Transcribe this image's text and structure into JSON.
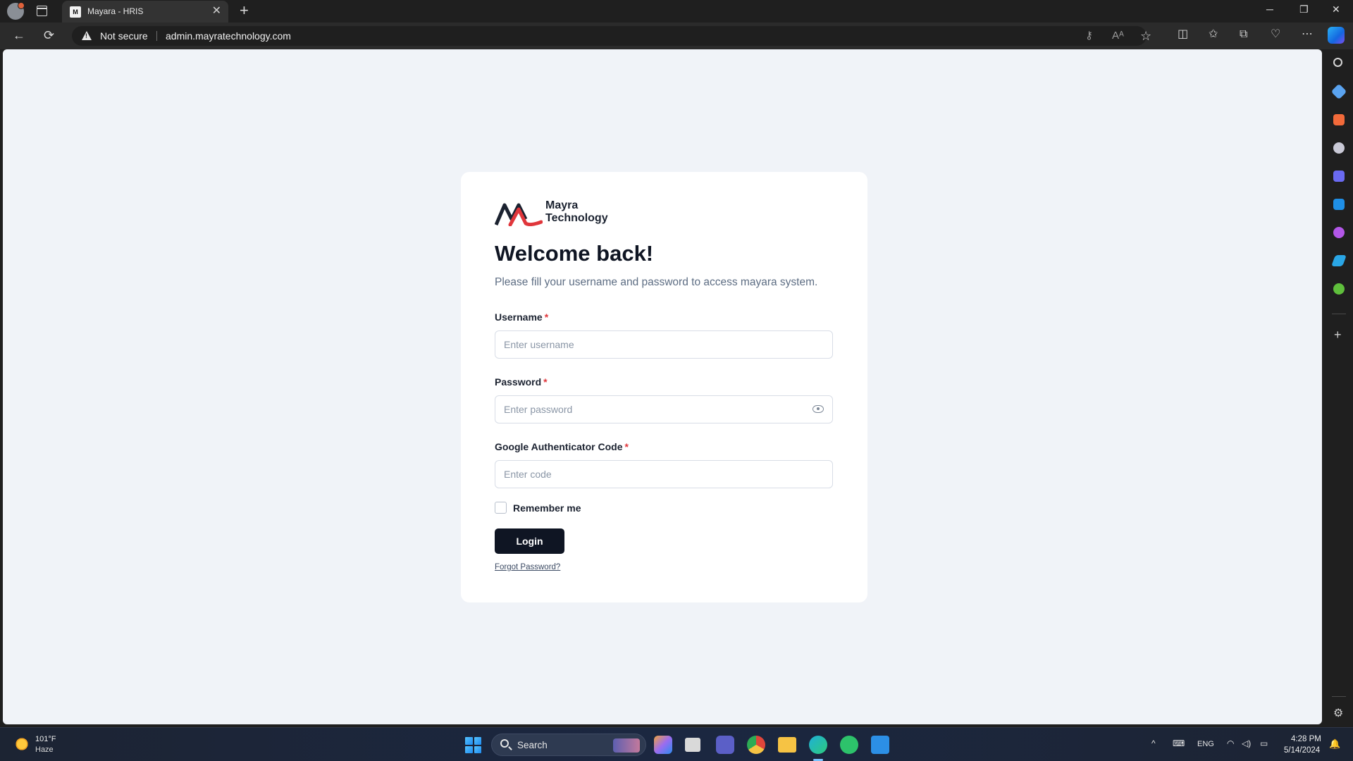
{
  "browser": {
    "tab_title": "Mayara - HRIS",
    "tab_favicon": "M",
    "close_tab": "✕",
    "new_tab": "+",
    "security_label": "Not secure",
    "url": "admin.mayratechnology.com",
    "window_controls": {
      "minimize": "─",
      "restore": "❐",
      "close": "✕"
    },
    "nav": {
      "back": "←",
      "refresh": "⟳"
    },
    "omnibox_icons": {
      "password_key": "⚷",
      "read_aloud": "Aᴬ",
      "favorite": "☆"
    },
    "toolbar_icons": {
      "split_screen": "◫",
      "favorites": "✩",
      "collections": "⧉",
      "browser_essentials": "♡",
      "more": "⋯"
    }
  },
  "sidebar": {
    "icons": [
      {
        "name": "search-icon",
        "color": "#d6d6d6"
      },
      {
        "name": "shopping-tag-icon",
        "color": "#5aa3f0"
      },
      {
        "name": "tools-icon",
        "color": "#f26a3a"
      },
      {
        "name": "games-icon",
        "color": "#c9c9d6"
      },
      {
        "name": "microsoft365-icon",
        "color": "#6a6af2"
      },
      {
        "name": "outlook-icon",
        "color": "#1f8fe6"
      },
      {
        "name": "designer-icon",
        "color": "#b357e8"
      },
      {
        "name": "telegram-icon",
        "color": "#2aa6e6"
      },
      {
        "name": "tree-icon",
        "color": "#5fbf3c"
      }
    ],
    "add": "+",
    "settings": "⚙"
  },
  "page": {
    "logo_line1": "Mayra",
    "logo_line2": "Technology",
    "title": "Welcome back!",
    "subtitle": "Please fill your username and password to access mayara system.",
    "required_mark": "*",
    "username": {
      "label": "Username",
      "placeholder": "Enter username",
      "value": ""
    },
    "password": {
      "label": "Password",
      "placeholder": "Enter password",
      "value": ""
    },
    "code": {
      "label": "Google Authenticator Code",
      "placeholder": "Enter code",
      "value": ""
    },
    "remember_label": "Remember me",
    "remember_checked": false,
    "login_label": "Login",
    "forgot_label": "Forgot Password?",
    "colors": {
      "accent": "#0f1523",
      "required": "#e0363b",
      "logo_red": "#e0363b",
      "background": "#f0f3f8"
    }
  },
  "taskbar": {
    "weather_temp": "101°F",
    "weather_condition": "Haze",
    "search_placeholder": "Search",
    "apps": [
      {
        "name": "copilot-app-icon",
        "color": "#9b6cf0"
      },
      {
        "name": "task-view-icon",
        "color": "#d9d9d9"
      },
      {
        "name": "teams-icon",
        "color": "#5b5fc7"
      },
      {
        "name": "chrome-icon",
        "color": "#e0463b"
      },
      {
        "name": "file-explorer-icon",
        "color": "#f6c344"
      },
      {
        "name": "edge-icon",
        "color": "#1fb0d8"
      },
      {
        "name": "whatsapp-icon",
        "color": "#2dc26b"
      },
      {
        "name": "vscode-icon",
        "color": "#2c8fe6"
      }
    ],
    "tray_chevron": "^",
    "keyboard": "⌨",
    "language": "ENG",
    "wifi": "◠",
    "volume": "◁)",
    "battery": "▭",
    "time": "4:28 PM",
    "date": "5/14/2024",
    "notifications": "🔔"
  }
}
